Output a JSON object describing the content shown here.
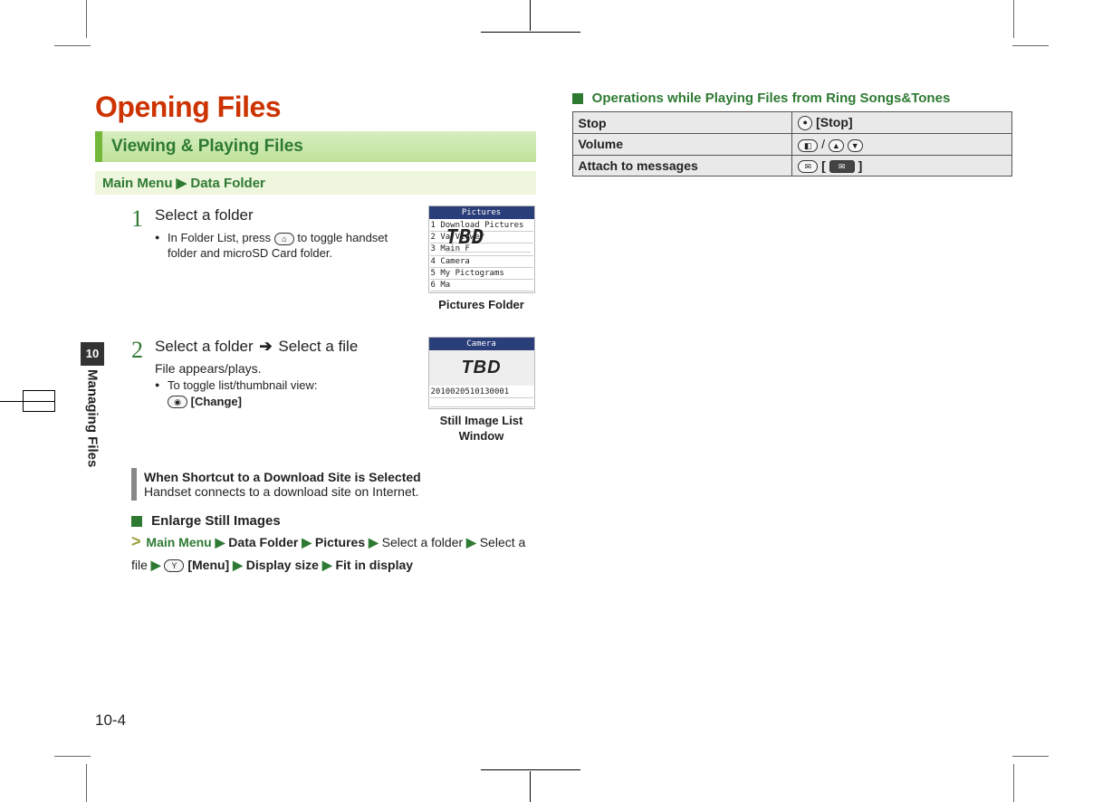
{
  "chapter": {
    "number": "10",
    "title": "Managing Files"
  },
  "title": "Opening Files",
  "section_bar": "Viewing & Playing Files",
  "breadcrumb": {
    "a": "Main Menu",
    "b": "Data Folder"
  },
  "steps": [
    {
      "num": "1",
      "head": "Select a folder",
      "sub1_pre": "In Folder List, press ",
      "sub1_post": " to toggle handset folder and microSD Card folder.",
      "shot_title": "Pictures",
      "shot_items": [
        "1 Download Pictures",
        "2 Va         Viewer",
        "3 Main F",
        "4 Camera",
        "5 My Pictograms",
        "6 Ma"
      ],
      "shot_overlay": "TBD",
      "caption": "Pictures Folder"
    },
    {
      "num": "2",
      "head_a": "Select a folder ",
      "head_arrow": "➔",
      "head_b": " Select a file",
      "line": "File appears/plays.",
      "sub_pre": "To toggle list/thumbnail view: ",
      "sub_key_label": "[Change]",
      "shot_title": "Camera",
      "shot_overlay": "TBD",
      "shot_filename": "2010020510130001",
      "caption": "Still Image List Window"
    }
  ],
  "note": {
    "title": "When Shortcut to a Download Site is Selected",
    "body": "Handset connects to a download site on Internet."
  },
  "enlarge": {
    "head": "Enlarge Still Images",
    "lead": ">",
    "p1": "Main Menu",
    "p2": "Data Folder",
    "p3": "Pictures",
    "p4a": "Select a folder",
    "p4b": "Select a file",
    "menu_label": "[Menu]",
    "p5": "Display size",
    "p6": "Fit in display"
  },
  "right": {
    "head": "Operations while Playing Files from Ring Songs&Tones",
    "rows": [
      {
        "label": "Stop",
        "action": "[Stop]"
      },
      {
        "label": "Volume",
        "action_sep": "/"
      },
      {
        "label": "Attach to messages",
        "action_open": "[",
        "action_close": "]"
      }
    ]
  },
  "pagenum": "10-4"
}
